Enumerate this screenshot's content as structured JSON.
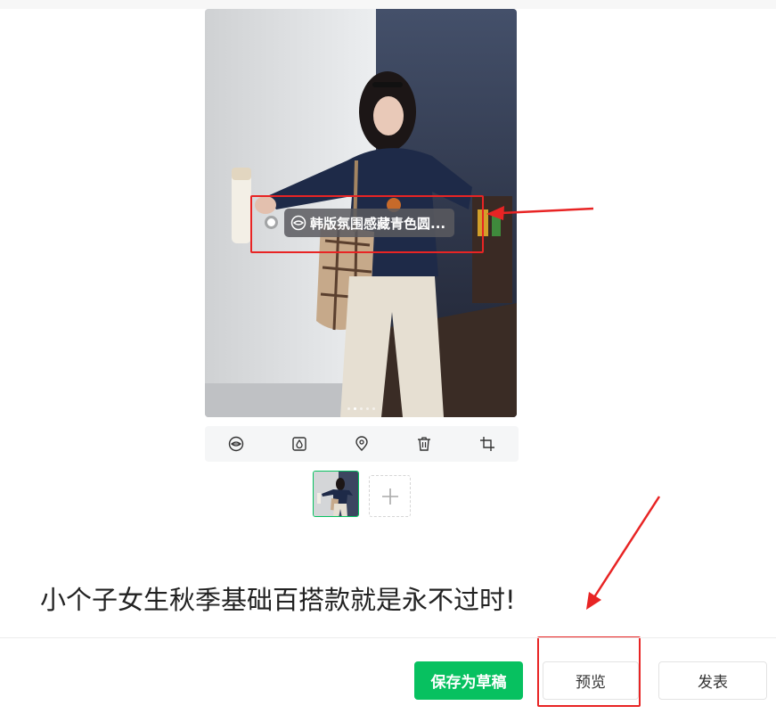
{
  "product_tag": {
    "label": "韩版氛围感藏青色圆...",
    "icon": "product-tag-icon"
  },
  "photo": {
    "page_count": 5,
    "active_page": 2
  },
  "toolbar": {
    "tools": [
      {
        "name": "product-tag-tool",
        "icon": "lips-tag-icon"
      },
      {
        "name": "filter-tool",
        "icon": "droplet-icon"
      },
      {
        "name": "location-tool",
        "icon": "map-pin-icon"
      },
      {
        "name": "delete-tool",
        "icon": "trash-icon"
      },
      {
        "name": "crop-tool",
        "icon": "crop-icon"
      }
    ]
  },
  "thumbnails": {
    "selected_index": 0,
    "add_icon": "plus-icon"
  },
  "post": {
    "title": "小个子女生秋季基础百搭款就是永不过时!"
  },
  "actions": {
    "save_draft": "保存为草稿",
    "preview": "预览",
    "publish": "发表"
  },
  "colors": {
    "primary_green": "#07c160",
    "annotation_red": "#e82424"
  }
}
